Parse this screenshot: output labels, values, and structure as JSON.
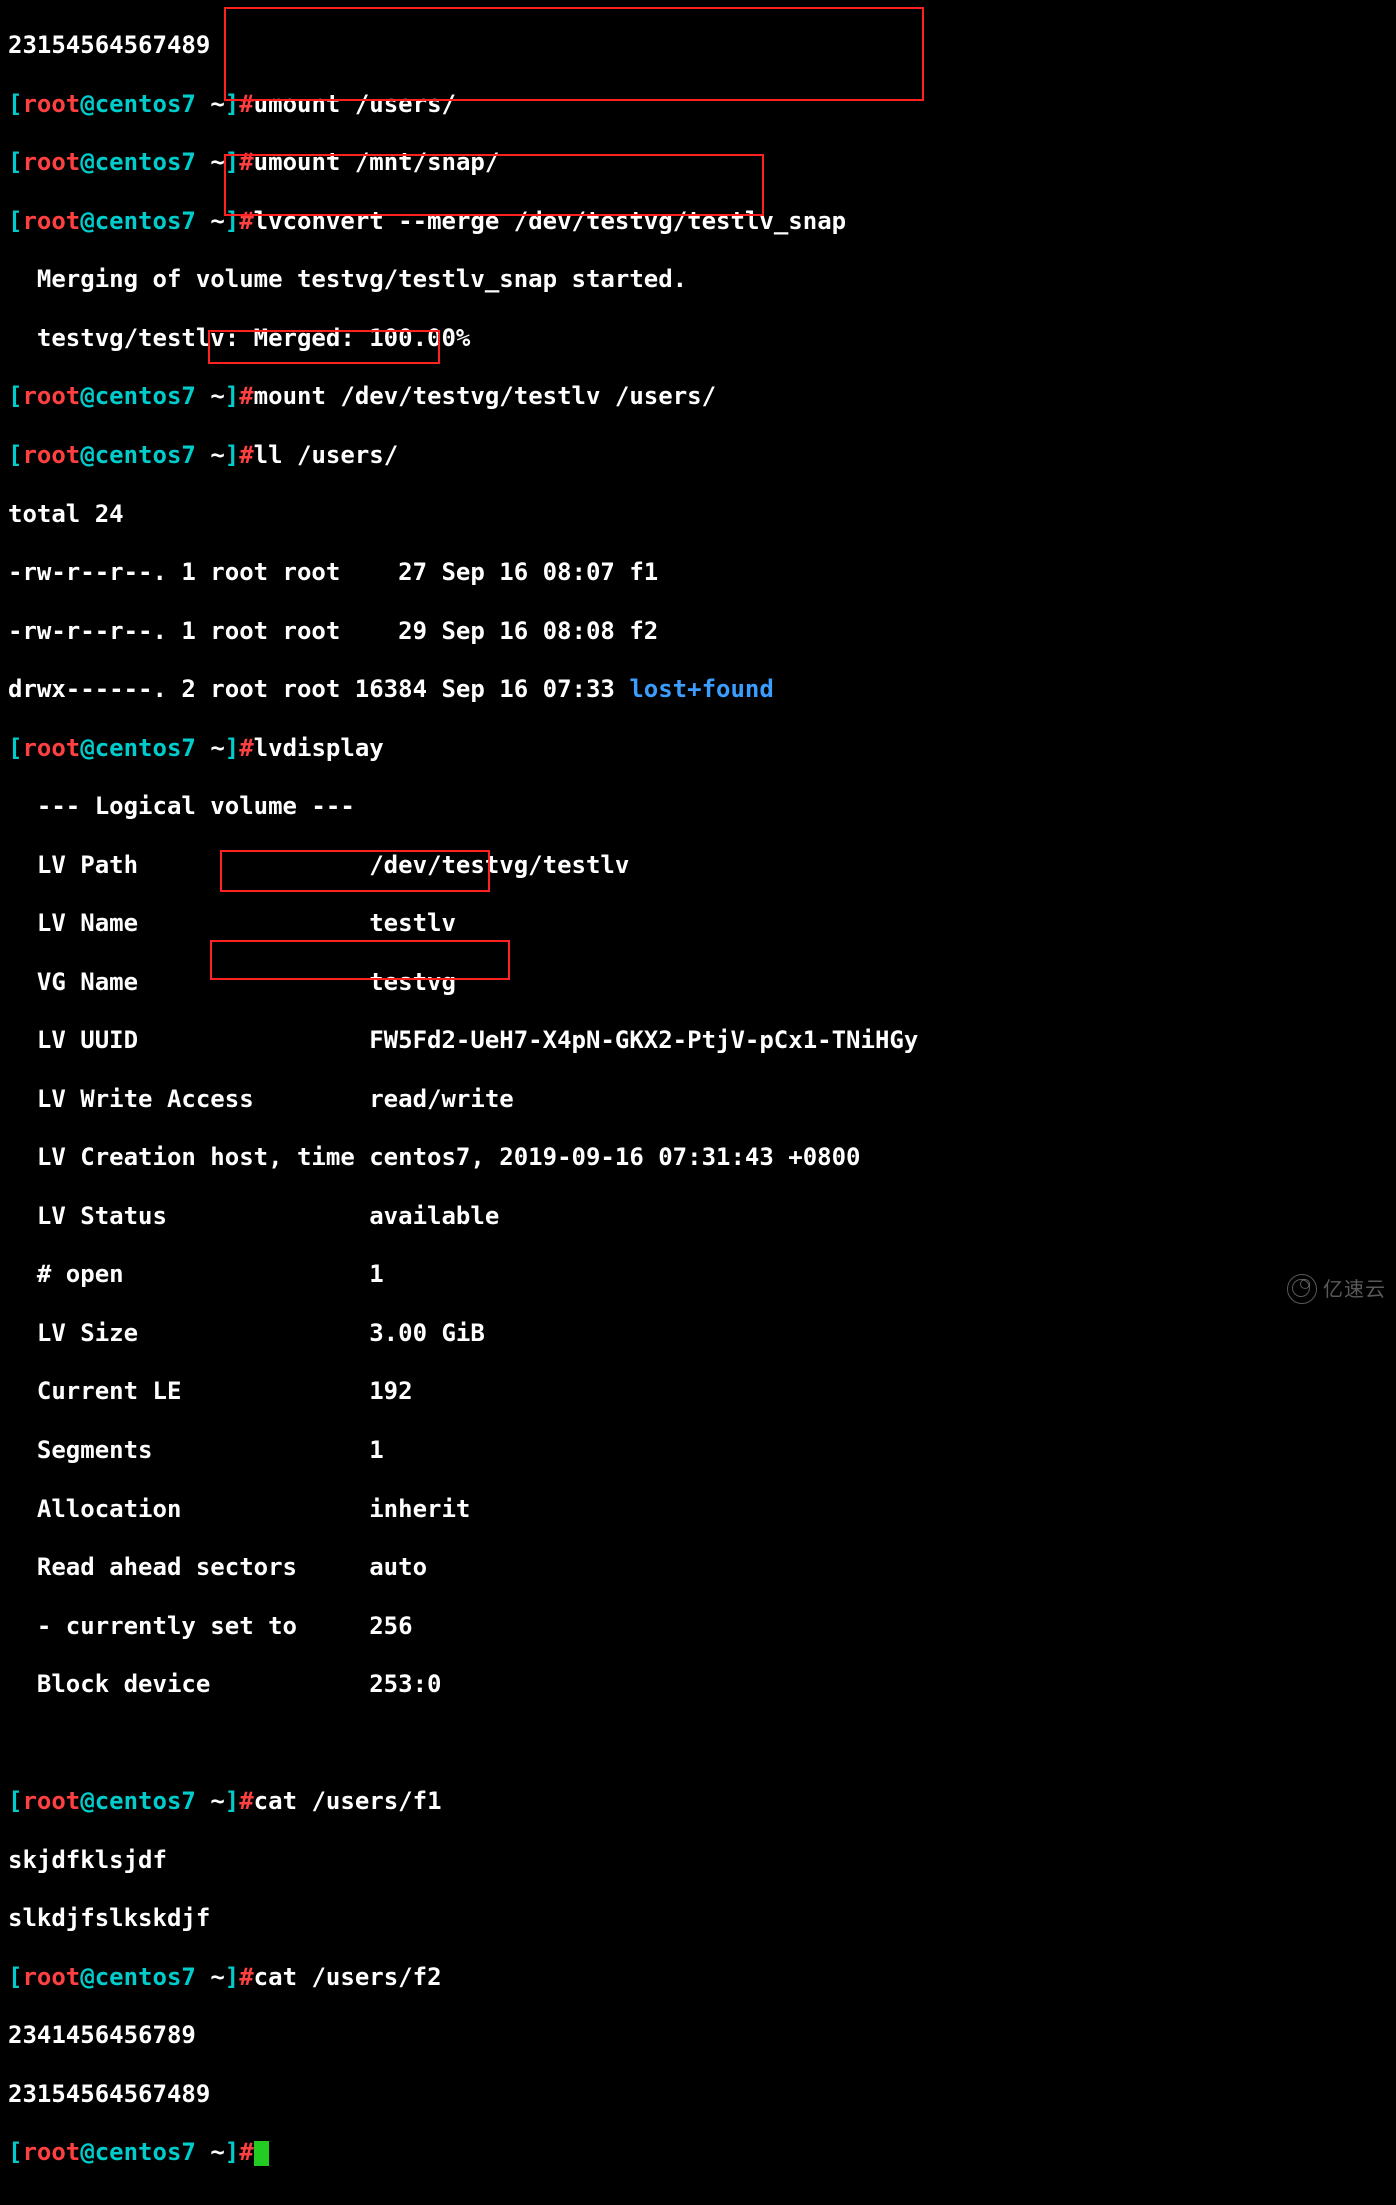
{
  "partial_top": "23154564567489",
  "prompts": {
    "umount_users": {
      "user": "root",
      "host": "centos7",
      "dir": "~",
      "cmd": "umount /users/"
    },
    "umount_mntsnap": {
      "user": "root",
      "host": "centos7",
      "dir": "~",
      "cmd": "umount /mnt/snap/"
    },
    "lvconvert": {
      "user": "root",
      "host": "centos7",
      "dir": "~",
      "cmd": "lvconvert --merge /dev/testvg/testlv_snap"
    },
    "mount": {
      "user": "root",
      "host": "centos7",
      "dir": "~",
      "cmd": "mount /dev/testvg/testlv /users/"
    },
    "ll": {
      "user": "root",
      "host": "centos7",
      "dir": "~",
      "cmd": "ll /users/"
    },
    "lvdisplay": {
      "user": "root",
      "host": "centos7",
      "dir": "~",
      "cmd": "lvdisplay"
    },
    "cat_f1": {
      "user": "root",
      "host": "centos7",
      "dir": "~",
      "cmd": "cat /users/f1"
    },
    "cat_f2": {
      "user": "root",
      "host": "centos7",
      "dir": "~",
      "cmd": "cat /users/f2"
    },
    "empty": {
      "user": "root",
      "host": "centos7",
      "dir": "~",
      "cmd": ""
    }
  },
  "lvconvert_out": {
    "l1": "  Merging of volume testvg/testlv_snap started.",
    "l2": "  testvg/testlv: Merged: 100.00%"
  },
  "ll_out": {
    "total": "total 24",
    "row1": "-rw-r--r--. 1 root root    27 Sep 16 08:07 f1",
    "row2": "-rw-r--r--. 1 root root    29 Sep 16 08:08 f2",
    "row3_prefix": "drwx------. 2 root root 16384 Sep 16 07:33 ",
    "row3_dir": "lost+found"
  },
  "lvdisplay_out": {
    "hdr": "  --- Logical volume ---",
    "path": "  LV Path                /dev/testvg/testlv",
    "name": "  LV Name                testlv",
    "vg": "  VG Name                testvg",
    "uuid": "  LV UUID                FW5Fd2-UeH7-X4pN-GKX2-PtjV-pCx1-TNiHGy",
    "wa": "  LV Write Access        read/write",
    "ctime": "  LV Creation host, time centos7, 2019-09-16 07:31:43 +0800",
    "stat": "  LV Status              available",
    "open": "  # open                 1",
    "size": "  LV Size                3.00 GiB",
    "cle": "  Current LE             192",
    "seg": "  Segments               1",
    "alloc": "  Allocation             inherit",
    "ras": "  Read ahead sectors     auto",
    "cur": "  - currently set to     256",
    "bdev": "  Block device           253:0",
    "blank": " "
  },
  "cat_f1_out": {
    "l1": "skjdfklsjdf",
    "l2": "slkdjfslkskdjf"
  },
  "cat_f2_out": {
    "l1": "2341456456789",
    "l2": "23154564567489"
  },
  "watermark": "亿速云"
}
